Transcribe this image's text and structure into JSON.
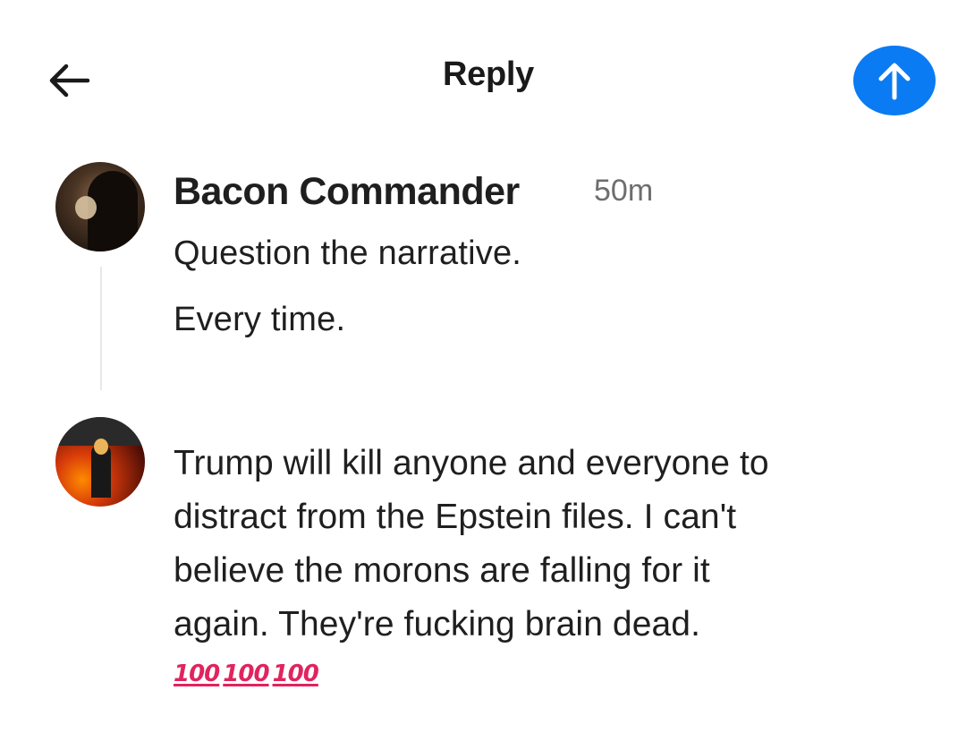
{
  "header": {
    "title": "Reply"
  },
  "parent_post": {
    "author": "Bacon Commander",
    "time": "50m",
    "lines": [
      "Question the narrative.",
      "Every time."
    ]
  },
  "reply": {
    "lines": [
      "Trump will kill anyone and everyone to",
      "distract from the Epstein files. I can't",
      "believe the morons are falling for it",
      "again. They're fucking brain dead."
    ],
    "emojis": [
      "100",
      "100",
      "100"
    ]
  },
  "icons": {
    "back": "arrow-left-icon",
    "send": "arrow-up-icon"
  },
  "colors": {
    "accent": "#0a7bf2",
    "emoji": "#e0245e",
    "muted": "#6e6e6e"
  }
}
